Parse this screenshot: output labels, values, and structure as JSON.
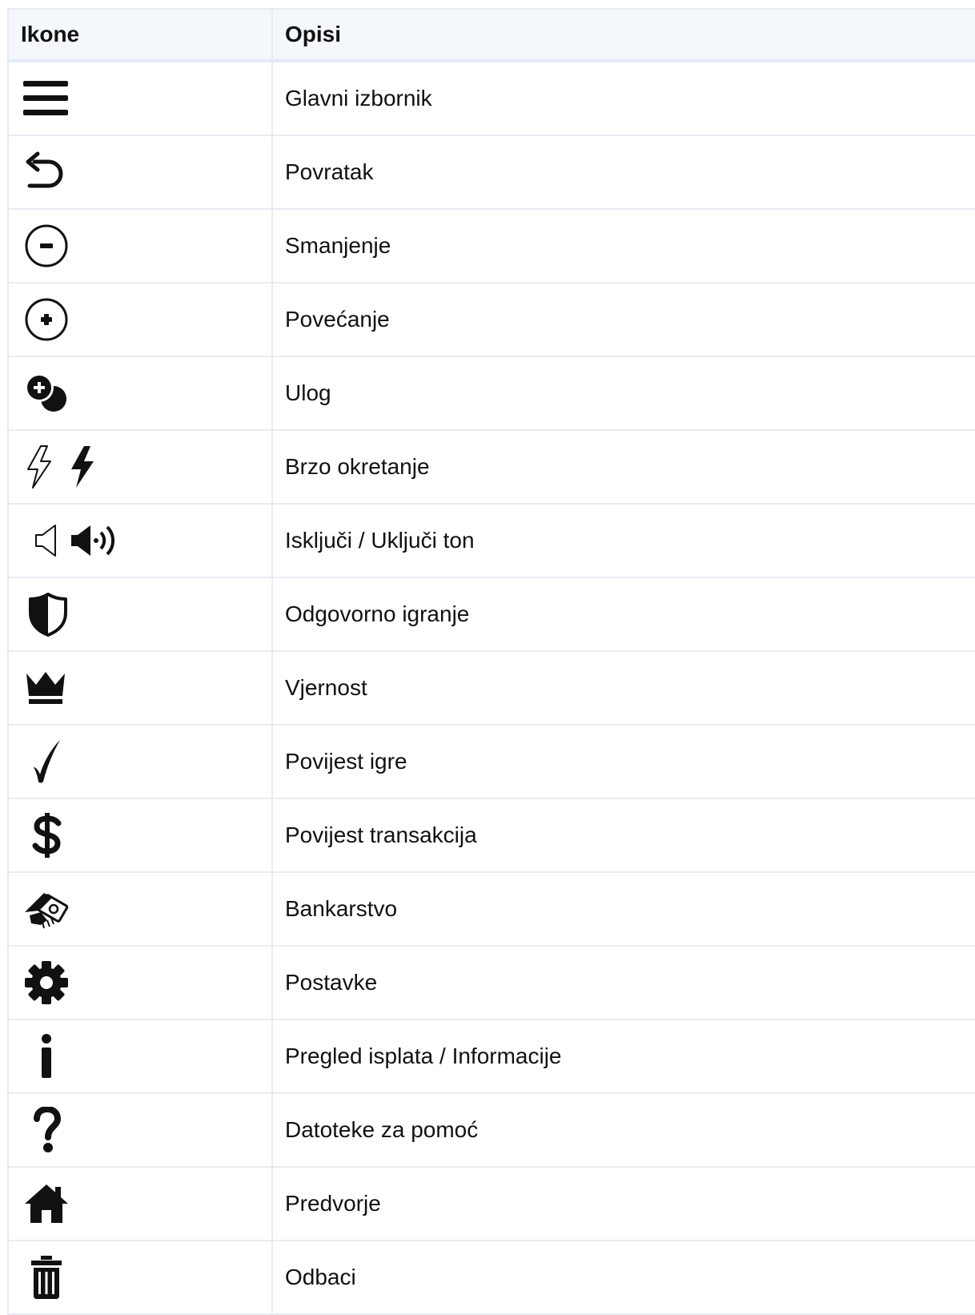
{
  "table": {
    "headers": {
      "icon_col": "Ikone",
      "desc_col": "Opisi"
    },
    "rows": [
      {
        "icon": "hamburger-menu-icon",
        "label": "Glavni izbornik"
      },
      {
        "icon": "undo-arrow-icon",
        "label": "Povratak"
      },
      {
        "icon": "minus-circle-icon",
        "label": "Smanjenje"
      },
      {
        "icon": "plus-circle-icon",
        "label": "Povećanje"
      },
      {
        "icon": "coins-plus-icon",
        "label": "Ulog"
      },
      {
        "icon": "lightning-icon",
        "label": "Brzo okretanje"
      },
      {
        "icon": "speaker-icon",
        "label": "Isključi / Uključi ton"
      },
      {
        "icon": "shield-icon",
        "label": "Odgovorno igranje"
      },
      {
        "icon": "crown-icon",
        "label": "Vjernost"
      },
      {
        "icon": "checkmark-icon",
        "label": "Povijest igre"
      },
      {
        "icon": "dollar-icon",
        "label": "Povijest transakcija"
      },
      {
        "icon": "banking-hand-icon",
        "label": "Bankarstvo"
      },
      {
        "icon": "gear-icon",
        "label": "Postavke"
      },
      {
        "icon": "info-icon",
        "label": "Pregled isplata / Informacije"
      },
      {
        "icon": "question-icon",
        "label": "Datoteke za pomoć"
      },
      {
        "icon": "home-icon",
        "label": "Predvorje"
      },
      {
        "icon": "trash-icon",
        "label": "Odbaci"
      }
    ]
  }
}
